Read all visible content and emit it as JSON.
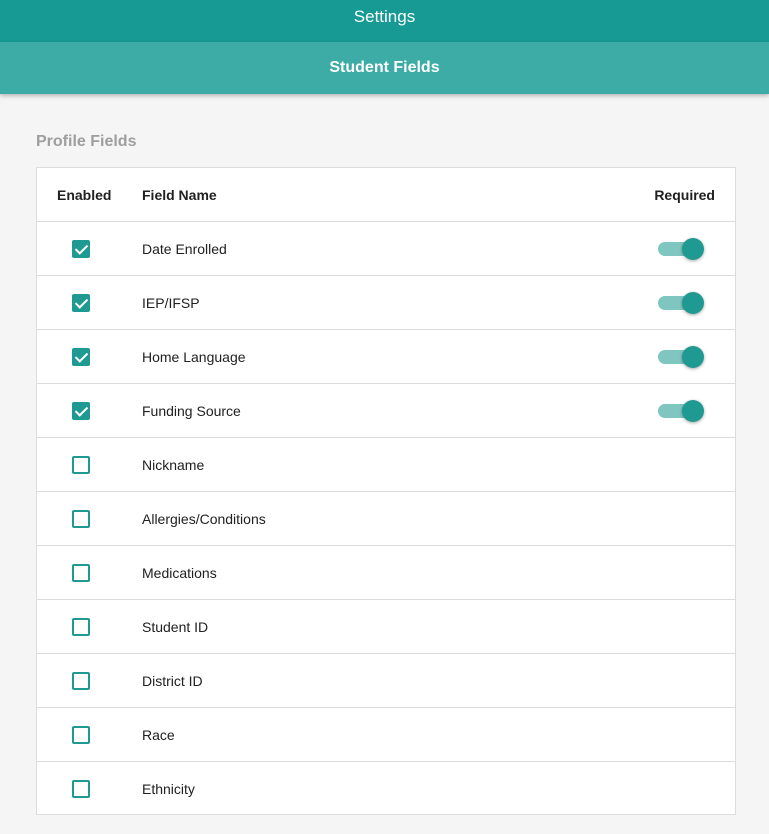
{
  "header": {
    "title": "Settings",
    "subtitle": "Student Fields"
  },
  "section": {
    "title": "Profile Fields"
  },
  "table": {
    "columns": {
      "enabled": "Enabled",
      "field_name": "Field Name",
      "required": "Required"
    },
    "rows": [
      {
        "name": "Date Enrolled",
        "enabled": true,
        "required": true
      },
      {
        "name": "IEP/IFSP",
        "enabled": true,
        "required": true
      },
      {
        "name": "Home Language",
        "enabled": true,
        "required": true
      },
      {
        "name": "Funding Source",
        "enabled": true,
        "required": true
      },
      {
        "name": "Nickname",
        "enabled": false,
        "required": false
      },
      {
        "name": "Allergies/Conditions",
        "enabled": false,
        "required": false
      },
      {
        "name": "Medications",
        "enabled": false,
        "required": false
      },
      {
        "name": "Student ID",
        "enabled": false,
        "required": false
      },
      {
        "name": "District ID",
        "enabled": false,
        "required": false
      },
      {
        "name": "Race",
        "enabled": false,
        "required": false
      },
      {
        "name": "Ethnicity",
        "enabled": false,
        "required": false
      }
    ]
  },
  "colors": {
    "primary": "#179a93",
    "secondary": "#3eaca6",
    "accent": "#1f9a92",
    "track": "#7fc6c1"
  },
  "icons": {
    "checkbox_checked": "checkbox-checked-icon",
    "checkbox_unchecked": "checkbox-unchecked-icon",
    "toggle_on": "toggle-on-icon"
  }
}
